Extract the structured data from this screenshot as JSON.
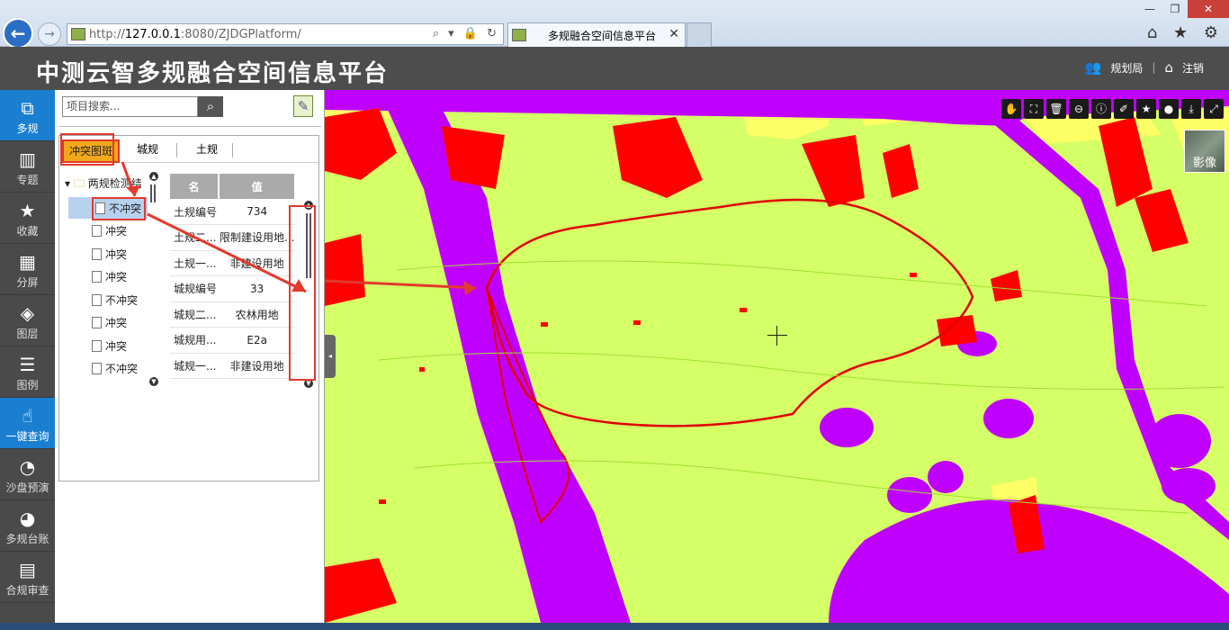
{
  "browser": {
    "url_prefix": "http://",
    "url_host": "127.0.0.1",
    "url_rest": ":8080/ZJDGPlatform/",
    "tab_title": "多规融合空间信息平台",
    "address_icons": "⌕ ▾ 🔒 ↻",
    "toolbar_icons": "⌂ ★ ⚙"
  },
  "app": {
    "title": "中测云智多规融合空间信息平台",
    "user_label": "规划局",
    "logout_label": "注销"
  },
  "nav": [
    {
      "label": "多规",
      "icon": "layers-icon",
      "glyph": "⧉",
      "active": true
    },
    {
      "label": "专题",
      "icon": "chart-icon",
      "glyph": "▥"
    },
    {
      "label": "收藏",
      "icon": "star-icon",
      "glyph": "★"
    },
    {
      "label": "分屏",
      "icon": "grid-icon",
      "glyph": "▦"
    },
    {
      "label": "图层",
      "icon": "stack-icon",
      "glyph": "◈"
    },
    {
      "label": "图例",
      "icon": "list-icon",
      "glyph": "☰"
    },
    {
      "label": "一键查询",
      "icon": "query-icon",
      "glyph": "☝",
      "active2": true
    },
    {
      "label": "沙盘预演",
      "icon": "gauge-icon",
      "glyph": "◔"
    },
    {
      "label": "多规台账",
      "icon": "pie-icon",
      "glyph": "◕"
    },
    {
      "label": "合规审查",
      "icon": "briefcase-icon",
      "glyph": "▤"
    }
  ],
  "panel": {
    "search_placeholder": "项目搜索...",
    "tabs": [
      "冲突图斑",
      "城规",
      "土规"
    ],
    "tree_root": "两规检测结",
    "tree_items": [
      "不冲突",
      "冲突",
      "冲突",
      "冲突",
      "不冲突",
      "冲突",
      "冲突",
      "不冲突"
    ],
    "table_headers": [
      "名",
      "值"
    ],
    "table_rows": [
      {
        "k": "土规编号",
        "v": "734"
      },
      {
        "k": "土规二...",
        "v": "限制建设用地..."
      },
      {
        "k": "土规一...",
        "v": "非建设用地"
      },
      {
        "k": "城规编号",
        "v": "33"
      },
      {
        "k": "城规二...",
        "v": "农林用地"
      },
      {
        "k": "城规用...",
        "v": "E2a"
      },
      {
        "k": "城规一...",
        "v": "非建设用地"
      }
    ]
  },
  "map": {
    "basemap_label": "影像",
    "tools": [
      "✋",
      "⛶",
      "🗑",
      "⊖",
      "ⓘ",
      "✐",
      "★",
      "●",
      "⤓",
      "⤢"
    ]
  },
  "colors": {
    "land_green": "#d5ff66",
    "purple": "#c000ff",
    "red": "#ff0000",
    "yellow": "#ffff66",
    "active_nav": "#1a7fd1",
    "highlight": "#e23a2e"
  }
}
